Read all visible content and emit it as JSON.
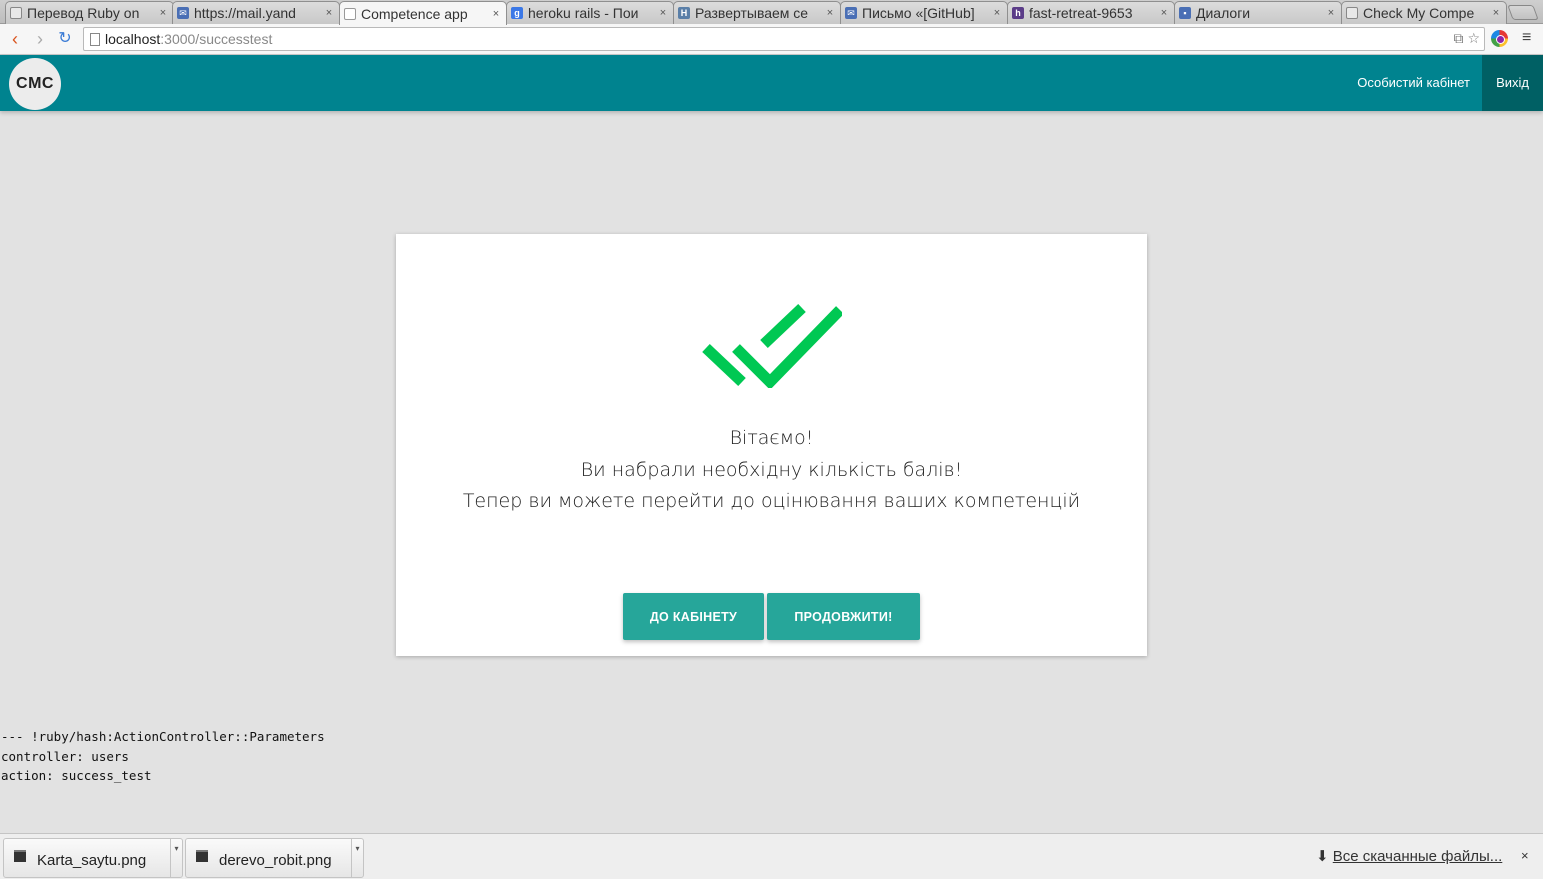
{
  "browser": {
    "tabs": [
      {
        "title": "Перевод Ruby on",
        "favicon": "page-icon",
        "color": "#666666",
        "active": false
      },
      {
        "title": "https://mail.yand",
        "favicon": "mail-icon",
        "color": "#4a6fb5",
        "active": false
      },
      {
        "title": "Competence app",
        "favicon": "page-icon",
        "color": "#888888",
        "active": true
      },
      {
        "title": "heroku rails - Пои",
        "favicon": "google-icon",
        "color": "#3b78e7",
        "active": false
      },
      {
        "title": "Развертываем се",
        "favicon": "habr-icon",
        "color": "#5a7fa8",
        "active": false
      },
      {
        "title": "Письмо «[GitHub]",
        "favicon": "mail-icon",
        "color": "#4a6fb5",
        "active": false
      },
      {
        "title": "fast-retreat-9653",
        "favicon": "heroku-icon",
        "color": "#5b3c88",
        "active": false
      },
      {
        "title": "Диалоги",
        "favicon": "chat-icon",
        "color": "#4a6fb5",
        "active": false
      },
      {
        "title": "Check My Compe",
        "favicon": "page-icon",
        "color": "#888888",
        "active": false
      }
    ],
    "close_glyph": "×",
    "url_host": "localhost",
    "url_path": ":3000/successtest"
  },
  "app": {
    "logo": "CMC",
    "nav": {
      "cabinet": "Особистий кабінет",
      "exit": "Вихід"
    },
    "colors": {
      "navbar": "#00838f",
      "accent_button": "#26a69a",
      "check": "#00c853"
    }
  },
  "card": {
    "line1": "Вітаємо!",
    "line2": "Ви набрали необхідну кількість балів!",
    "line3": "Тепер ви можете перейти до оцінювання ваших компетенцій",
    "btn_cabinet": "ДО КАБІНЕТУ",
    "btn_continue": "ПРОДОВЖИТИ!"
  },
  "debug": {
    "line1": "--- !ruby/hash:ActionController::Parameters",
    "line2": "controller: users",
    "line3": "action: success_test"
  },
  "downloads": {
    "files": [
      "Karta_saytu.png",
      "derevo_robit.png"
    ],
    "all_files": "Все скачанные файлы...",
    "close_glyph": "×"
  }
}
